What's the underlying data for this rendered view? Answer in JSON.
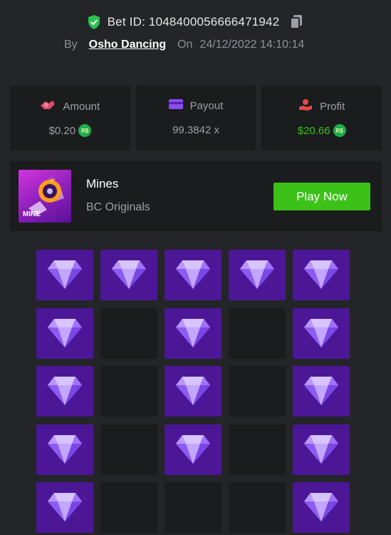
{
  "header": {
    "bet_id_label": "Bet ID: 1048400056666471942",
    "by_label": "By",
    "username": "Osho Dancing",
    "on_label": "On",
    "datetime": "24/12/2022 14:10:14"
  },
  "stats": {
    "amount": {
      "label": "Amount",
      "value": "$0.20",
      "currency_badge": "R$"
    },
    "payout": {
      "label": "Payout",
      "value": "99.3842 x"
    },
    "profit": {
      "label": "Profit",
      "value": "$20.66",
      "currency_badge": "R$"
    }
  },
  "game": {
    "name": "Mines",
    "provider": "BC Originals",
    "thumb_text": "MINE",
    "play_button": "Play Now"
  },
  "colors": {
    "background": "#232528",
    "card": "#1b1c1e",
    "accent_green": "#3bc117",
    "gem_tile": "#4b1796"
  },
  "grid": {
    "columns": 5,
    "rows_visible": 5,
    "cells": [
      "gem",
      "gem",
      "gem",
      "gem",
      "gem",
      "gem",
      "empty",
      "gem",
      "empty",
      "gem",
      "gem",
      "empty",
      "gem",
      "empty",
      "gem",
      "gem",
      "empty",
      "gem",
      "empty",
      "gem",
      "gem",
      "empty",
      "empty",
      "empty",
      "gem"
    ]
  }
}
